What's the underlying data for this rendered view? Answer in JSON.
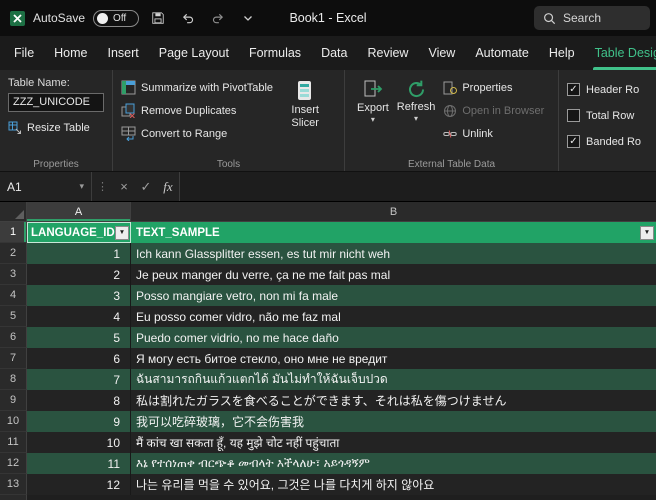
{
  "titlebar": {
    "autosave_label": "AutoSave",
    "autosave_state": "Off",
    "title": "Book1 - Excel",
    "search_label": "Search"
  },
  "tabs": [
    "File",
    "Home",
    "Insert",
    "Page Layout",
    "Formulas",
    "Data",
    "Review",
    "View",
    "Automate",
    "Help",
    "Table Design"
  ],
  "ribbon": {
    "table_name_label": "Table Name:",
    "table_name_value": "ZZZ_UNICODE",
    "resize_table_label": "Resize Table",
    "properties_group_label": "Properties",
    "summarize_label": "Summarize with PivotTable",
    "remove_duplicates_label": "Remove Duplicates",
    "convert_to_range_label": "Convert to Range",
    "insert_slicer_label": "Insert Slicer",
    "tools_group_label": "Tools",
    "export_label": "Export",
    "refresh_label": "Refresh",
    "properties_item_label": "Properties",
    "open_in_browser_label": "Open in Browser",
    "unlink_label": "Unlink",
    "external_group_label": "External Table Data",
    "style_options": [
      {
        "label": "Header Ro",
        "checked": true,
        "mark": "✓"
      },
      {
        "label": "Total Row",
        "checked": false,
        "mark": ""
      },
      {
        "label": "Banded Ro",
        "checked": true,
        "mark": "✓"
      }
    ]
  },
  "formula_bar": {
    "name_box": "A1",
    "formula_value": ""
  },
  "icons": {
    "filter_arrow": "▼",
    "name_box_chevron": "▾",
    "divider_dots": "⋮",
    "cancel": "×",
    "enter": "✓",
    "fx": "fx",
    "dropdown_chevron": "▾"
  },
  "sheet": {
    "columns": [
      "A",
      "B"
    ],
    "header_row_num": "1",
    "header": {
      "language_id": "LANGUAGE_ID",
      "text_sample": "TEXT_SAMPLE"
    },
    "rows": [
      {
        "row": "2",
        "id": "1",
        "text": "Ich kann Glassplitter essen, es tut mir nicht weh"
      },
      {
        "row": "3",
        "id": "2",
        "text": "Je peux manger du verre, ça ne me fait pas mal"
      },
      {
        "row": "4",
        "id": "3",
        "text": "Posso mangiare vetro, non mi fa male"
      },
      {
        "row": "5",
        "id": "4",
        "text": "Eu posso comer vidro, não me faz mal"
      },
      {
        "row": "6",
        "id": "5",
        "text": "Puedo comer vidrio, no me hace daño"
      },
      {
        "row": "7",
        "id": "6",
        "text": "Я могу есть битое стекло, оно мне не вредит"
      },
      {
        "row": "8",
        "id": "7",
        "text": "ฉันสามารถกินแก้วแตกได้ มันไม่ทำให้ฉันเจ็บปวด"
      },
      {
        "row": "9",
        "id": "8",
        "text": "私は割れたガラスを食べることができます、それは私を傷つけません"
      },
      {
        "row": "10",
        "id": "9",
        "text": "我可以吃碎玻璃，它不会伤害我"
      },
      {
        "row": "11",
        "id": "10",
        "text": "मैं कांच खा सकता हूँ, यह मुझे चोट नहीं पहुंचाता"
      },
      {
        "row": "12",
        "id": "11",
        "text": "እኔ የተሰነጠቀ ብርጭቆ መብላት እችላለሁ፣ አይጎዳኝም"
      },
      {
        "row": "13",
        "id": "12",
        "text": "나는 유리를 먹을 수 있어요, 그것은 나를 다치게 하지 않아요"
      }
    ]
  },
  "colors": {
    "accent_green": "#21a366",
    "active_tab_green": "#40c18a",
    "band_stripe": "#2a5340",
    "row_plain": "#232323"
  }
}
